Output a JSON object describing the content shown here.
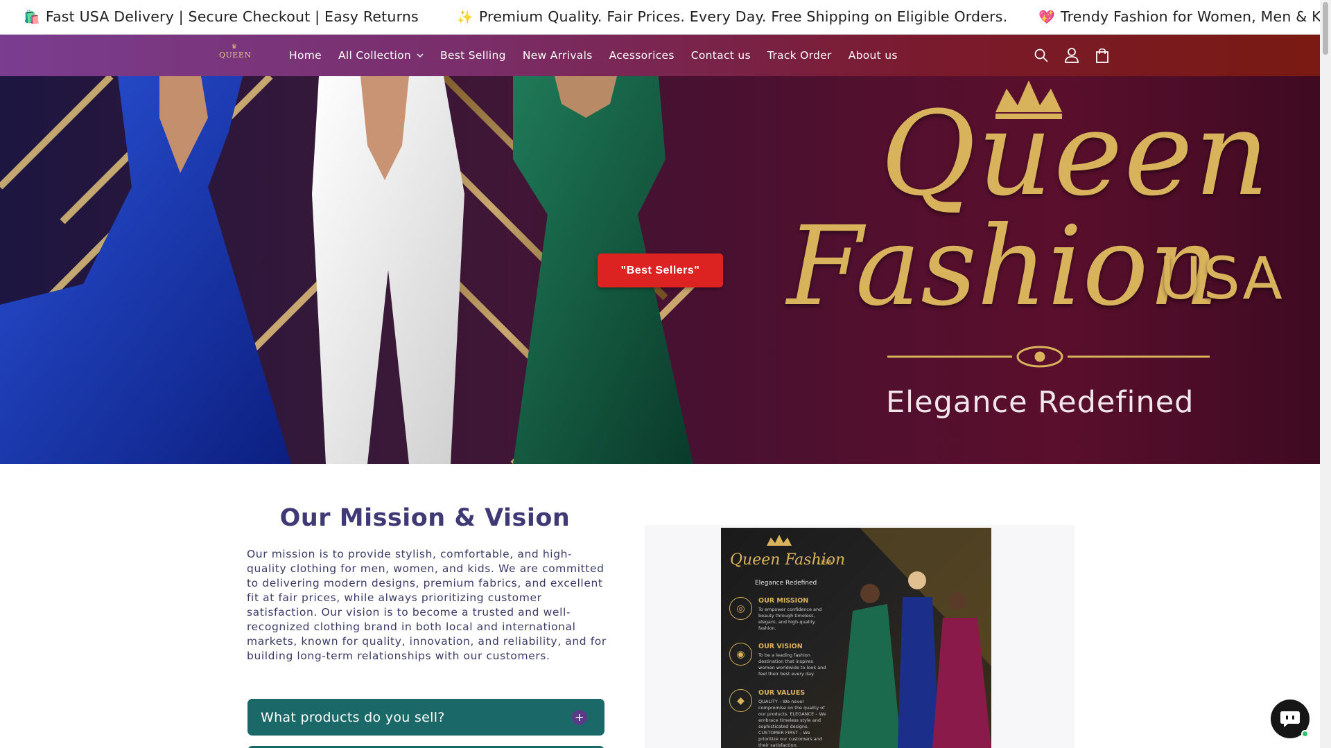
{
  "announcement": {
    "messages": [
      {
        "emoji": "🛍️",
        "text": "Fast USA Delivery | Secure Checkout | Easy Returns"
      },
      {
        "emoji": "✨",
        "text": "Premium Quality. Fair Prices. Every Day. Free Shipping on Eligible Orders."
      },
      {
        "emoji": "💖",
        "text": "Trendy Fashion for Women, Men & Kids"
      }
    ]
  },
  "header": {
    "logo_text": "QUEEN",
    "nav": [
      {
        "label": "Home"
      },
      {
        "label": "All Collection",
        "has_dropdown": true
      },
      {
        "label": "Best Selling"
      },
      {
        "label": "New Arrivals"
      },
      {
        "label": "Acessorices"
      },
      {
        "label": "Contact us"
      },
      {
        "label": "Track Order"
      },
      {
        "label": "About us"
      }
    ],
    "icons": [
      "search-icon",
      "account-icon",
      "cart-icon"
    ]
  },
  "hero": {
    "brand_line1": "Queen",
    "brand_line2": "Fashion",
    "brand_usa": "USA",
    "tagline": "Elegance Redefined",
    "button_label": "\"Best Sellers\""
  },
  "mission": {
    "title": "Our Mission & Vision",
    "body": "Our mission is to provide stylish, comfortable, and high-quality clothing for men, women, and kids. We are committed to delivering modern designs, premium fabrics, and excellent fit at fair prices, while always prioritizing customer satisfaction. Our vision is to become a trusted and well-recognized clothing brand in both local and international markets, known for quality, innovation, and reliability, and for building long-term relationships with our customers.",
    "faq": [
      {
        "question": "What products do you sell?"
      }
    ]
  },
  "poster": {
    "title": "Queen Fashion",
    "usa": "USA",
    "subtitle": "Elegance Redefined",
    "sections": [
      {
        "heading": "OUR MISSION",
        "text": "To empower confidence and beauty through timeless, elegant, and high-quality fashion."
      },
      {
        "heading": "OUR VISION",
        "text": "To be a leading fashion destination that inspires women worldwide to look and feel their best every day."
      },
      {
        "heading": "OUR VALUES",
        "text": "QUALITY – We never compromise on the quality of our products. ELEGANCE – We embrace timeless style and sophisticated designs. CUSTOMER FIRST – We prioritize our customers and their satisfaction."
      }
    ]
  },
  "colors": {
    "header_start": "#7a3d8f",
    "header_end": "#7a1a12",
    "cta_red": "#dd2222",
    "gold": "#d9b25c",
    "mission_text": "#3a3a66",
    "faq_teal": "#1a6868"
  }
}
